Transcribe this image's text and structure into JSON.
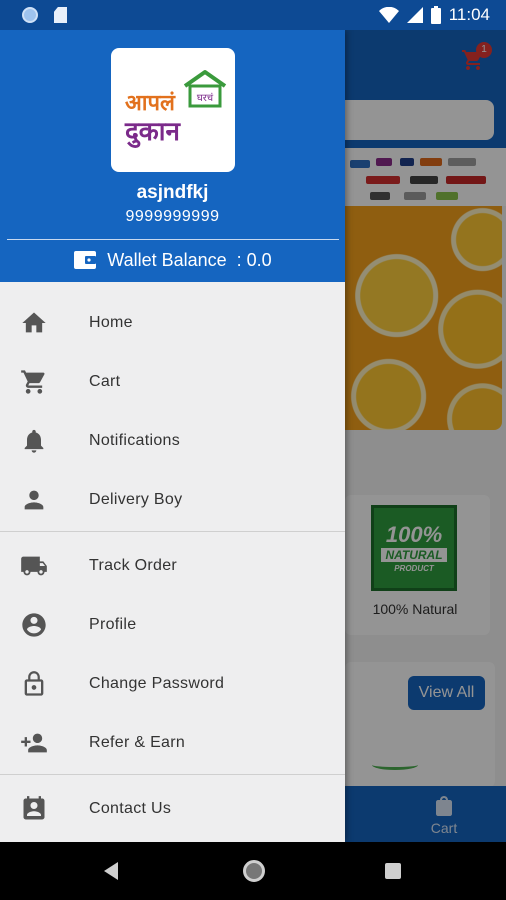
{
  "status_bar": {
    "time": "11:04",
    "icons": [
      "notification-dot-icon",
      "sd-card-icon",
      "wifi-icon",
      "signal-icon",
      "battery-icon"
    ]
  },
  "drawer": {
    "logo_alt": "आपलं घरचं दुकान",
    "logo_text_line1": "आपलं",
    "logo_text_house": "घरचं",
    "logo_text_line2": "दुकान",
    "user_name": "asjndfkj",
    "user_phone": "9999999999",
    "wallet_label": "Wallet Balance",
    "wallet_value": " : 0.0",
    "menu_group1": [
      {
        "label": "Home",
        "icon": "home-icon"
      },
      {
        "label": "Cart",
        "icon": "cart-icon"
      },
      {
        "label": "Notifications",
        "icon": "bell-icon"
      },
      {
        "label": "Delivery Boy",
        "icon": "person-icon"
      }
    ],
    "menu_group2": [
      {
        "label": "Track Order",
        "icon": "truck-icon"
      },
      {
        "label": "Profile",
        "icon": "account-circle-icon"
      },
      {
        "label": "Change Password",
        "icon": "lock-icon"
      },
      {
        "label": "Refer & Earn",
        "icon": "person-add-icon"
      }
    ],
    "menu_group3": [
      {
        "label": "Contact Us",
        "icon": "contact-icon"
      }
    ]
  },
  "background_app": {
    "cart_badge": "1",
    "product_name": "100% Natural",
    "badge_line1": "100%",
    "badge_line2": "NATURAL",
    "badge_line3": "PRODUCT",
    "view_all": "View All",
    "bottom_nav_cart": "Cart"
  },
  "colors": {
    "primary": "#1565c0",
    "drawer_bg": "#eeeeef",
    "logo_orange": "#e2711d",
    "logo_green": "#3a9a3c",
    "logo_purple": "#7b2a8a"
  }
}
